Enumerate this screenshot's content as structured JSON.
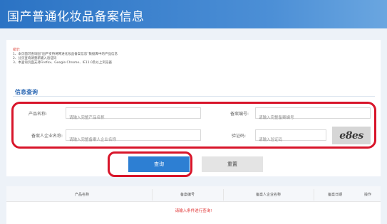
{
  "header": {
    "title": "国产普通化妆品备案信息"
  },
  "notice": {
    "tip_label": "提示:",
    "lines": [
      "1、本页面可查询国“国产支持将网进化妆品备案信息”数据库中的产品信息",
      "2、分页查询请重新输入验证码",
      "3、本查询页面支持Firefox、Google Chrome、IE11.0及以上浏览器"
    ]
  },
  "section": {
    "title": "信息查询"
  },
  "form": {
    "product_name_label": "产品名称:",
    "product_name_placeholder": "请输入完整产品名称",
    "record_no_label": "备案编号:",
    "record_no_placeholder": "请输入完整备案编号",
    "company_label": "备案人企业名称:",
    "company_placeholder": "请输入完整备案人企业名称",
    "captcha_label": "验证码:",
    "captcha_placeholder": "请输入验证码",
    "captcha_text": "e8es"
  },
  "buttons": {
    "search": "查询",
    "reset": "重置"
  },
  "table": {
    "headers": [
      "产品名称",
      "备案编号",
      "备案人企业名称",
      "备案日期",
      "操作"
    ],
    "empty_message": "请输入条件进行查询!"
  }
}
